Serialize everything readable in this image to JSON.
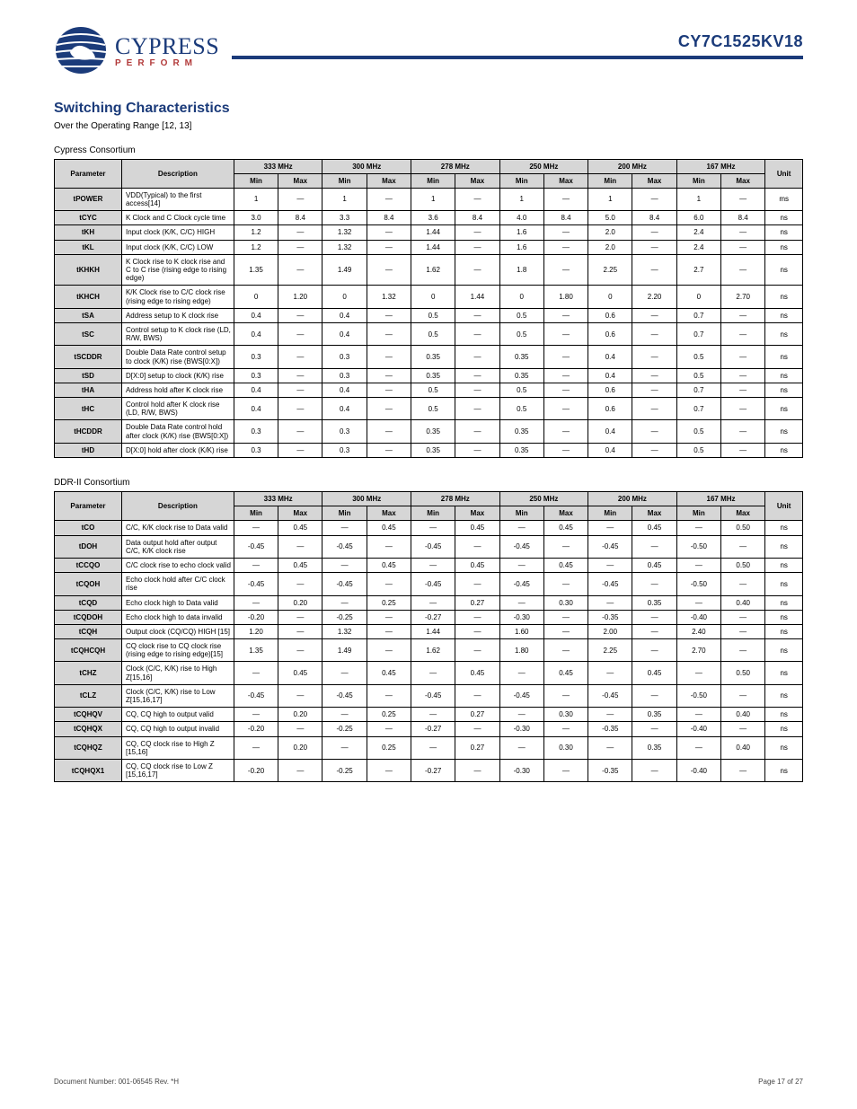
{
  "brand": {
    "name": "CYPRESS",
    "tag": "PERFORM"
  },
  "part_number": "CY7C1525KV18",
  "section_title": "Switching Characteristics",
  "section_intro": "Over the Operating Range [12, 13]",
  "table1_caption": "Cypress Consortium",
  "table2_caption": "DDR-II Consortium",
  "headers": [
    "Parameter",
    "Description",
    "333 MHz",
    "300 MHz",
    "278 MHz",
    "250 MHz",
    "200 MHz",
    "167 MHz",
    "Unit"
  ],
  "subheaders": [
    "",
    "",
    "Min",
    "Max",
    "Min",
    "Max",
    "Min",
    "Max",
    "Min",
    "Max",
    "Min",
    "Max",
    "Min",
    "Max",
    ""
  ],
  "cons_t1_cols": [
    "Parameter",
    "Description",
    "Min",
    "Max",
    "Min",
    "Max",
    "Min",
    "Max",
    "Min",
    "Max",
    "Min",
    "Max",
    "Min",
    "Max",
    "Unit"
  ],
  "t1_freq_row": [
    "",
    "",
    "333 MHz",
    "300 MHz",
    "278 MHz",
    "250 MHz",
    "200 MHz",
    "167 MHz",
    ""
  ],
  "t1_rows": [
    [
      "tPOWER",
      "",
      "VDD(Typical) to the first access[14]",
      "1",
      "—",
      "1",
      "—",
      "1",
      "—",
      "1",
      "—",
      "1",
      "—",
      "1",
      "—",
      "ms"
    ],
    [
      "tCYC",
      "",
      "K Clock and C Clock cycle time",
      "3.0",
      "8.4",
      "3.3",
      "8.4",
      "3.6",
      "8.4",
      "4.0",
      "8.4",
      "5.0",
      "8.4",
      "6.0",
      "8.4",
      "ns"
    ],
    [
      "tKH",
      "",
      "Input clock (K/K, C/C) HIGH",
      "1.2",
      "—",
      "1.32",
      "—",
      "1.44",
      "—",
      "1.6",
      "—",
      "2.0",
      "—",
      "2.4",
      "—",
      "ns"
    ],
    [
      "tKL",
      "",
      "Input clock (K/K, C/C) LOW",
      "1.2",
      "—",
      "1.32",
      "—",
      "1.44",
      "—",
      "1.6",
      "—",
      "2.0",
      "—",
      "2.4",
      "—",
      "ns"
    ],
    [
      "tKHKH",
      "",
      "K Clock rise to K clock rise and C\nto C rise (rising edge to rising edge)",
      "1.35",
      "—",
      "1.49",
      "—",
      "1.62",
      "—",
      "1.8",
      "—",
      "2.25",
      "—",
      "2.7",
      "—",
      "ns"
    ],
    [
      "tKHCH",
      "",
      "K/K Clock rise to C/C clock rise\n(rising edge to rising edge)",
      "0",
      "1.20",
      "0",
      "1.32",
      "0",
      "1.44",
      "0",
      "1.80",
      "0",
      "2.20",
      "0",
      "2.70",
      "ns"
    ],
    [
      "tSA",
      "",
      "Address setup to K clock rise",
      "0.4",
      "—",
      "0.4",
      "—",
      "0.5",
      "—",
      "0.5",
      "—",
      "0.6",
      "—",
      "0.7",
      "—",
      "ns"
    ],
    [
      "tSC",
      "",
      "Control setup to K clock rise\n(LD, R/W, BWS)",
      "0.4",
      "—",
      "0.4",
      "—",
      "0.5",
      "—",
      "0.5",
      "—",
      "0.6",
      "—",
      "0.7",
      "—",
      "ns"
    ],
    [
      "tSCDDR",
      "",
      "Double Data Rate control setup to\nclock (K/K) rise (BWS[0:X])",
      "0.3",
      "—",
      "0.3",
      "—",
      "0.35",
      "—",
      "0.35",
      "—",
      "0.4",
      "—",
      "0.5",
      "—",
      "ns"
    ],
    [
      "tSD",
      "",
      "D[X:0] setup to clock (K/K) rise",
      "0.3",
      "—",
      "0.3",
      "—",
      "0.35",
      "—",
      "0.35",
      "—",
      "0.4",
      "—",
      "0.5",
      "—",
      "ns"
    ],
    [
      "tHA",
      "",
      "Address hold after K clock rise",
      "0.4",
      "—",
      "0.4",
      "—",
      "0.5",
      "—",
      "0.5",
      "—",
      "0.6",
      "—",
      "0.7",
      "—",
      "ns"
    ],
    [
      "tHC",
      "",
      "Control hold after K clock rise\n(LD, R/W, BWS)",
      "0.4",
      "—",
      "0.4",
      "—",
      "0.5",
      "—",
      "0.5",
      "—",
      "0.6",
      "—",
      "0.7",
      "—",
      "ns"
    ],
    [
      "tHCDDR",
      "",
      "Double Data Rate control hold after\nclock (K/K) rise (BWS[0:X])",
      "0.3",
      "—",
      "0.3",
      "—",
      "0.35",
      "—",
      "0.35",
      "—",
      "0.4",
      "—",
      "0.5",
      "—",
      "ns"
    ],
    [
      "tHD",
      "",
      "D[X:0] hold after clock (K/K) rise",
      "0.3",
      "—",
      "0.3",
      "—",
      "0.35",
      "—",
      "0.35",
      "—",
      "0.4",
      "—",
      "0.5",
      "—",
      "ns"
    ]
  ],
  "t2_rows": [
    [
      "tCO",
      "",
      "C/C, K/K clock rise to Data valid",
      "—",
      "0.45",
      "—",
      "0.45",
      "—",
      "0.45",
      "—",
      "0.45",
      "—",
      "0.45",
      "—",
      "0.50",
      "ns"
    ],
    [
      "tDOH",
      "",
      "Data output hold after output\nC/C, K/K clock rise",
      "-0.45",
      "—",
      "-0.45",
      "—",
      "-0.45",
      "—",
      "-0.45",
      "—",
      "-0.45",
      "—",
      "-0.50",
      "—",
      "ns"
    ],
    [
      "tCCQO",
      "",
      "C/C clock rise to echo clock valid",
      "—",
      "0.45",
      "—",
      "0.45",
      "—",
      "0.45",
      "—",
      "0.45",
      "—",
      "0.45",
      "—",
      "0.50",
      "ns"
    ],
    [
      "tCQOH",
      "",
      "Echo clock hold after\nC/C clock rise",
      "-0.45",
      "—",
      "-0.45",
      "—",
      "-0.45",
      "—",
      "-0.45",
      "—",
      "-0.45",
      "—",
      "-0.50",
      "—",
      "ns"
    ],
    [
      "tCQD",
      "",
      "Echo clock high to Data valid",
      "—",
      "0.20",
      "—",
      "0.25",
      "—",
      "0.27",
      "—",
      "0.30",
      "—",
      "0.35",
      "—",
      "0.40",
      "ns"
    ],
    [
      "tCQDOH",
      "",
      "Echo clock high to data\ninvalid",
      "-0.20",
      "—",
      "-0.25",
      "—",
      "-0.27",
      "—",
      "-0.30",
      "—",
      "-0.35",
      "—",
      "-0.40",
      "—",
      "ns"
    ],
    [
      "tCQH",
      "",
      "Output clock (CQ/CQ) HIGH [15]",
      "1.20",
      "—",
      "1.32",
      "—",
      "1.44",
      "—",
      "1.60",
      "—",
      "2.00",
      "—",
      "2.40",
      "—",
      "ns"
    ],
    [
      "tCQHCQH",
      "",
      "CQ clock rise to CQ clock rise\n(rising edge to rising edge)[15]",
      "1.35",
      "—",
      "1.49",
      "—",
      "1.62",
      "—",
      "1.80",
      "—",
      "2.25",
      "—",
      "2.70",
      "—",
      "ns"
    ],
    [
      "tCHZ",
      "",
      "Clock (C/C, K/K) rise to\nHigh Z[15,16]",
      "—",
      "0.45",
      "—",
      "0.45",
      "—",
      "0.45",
      "—",
      "0.45",
      "—",
      "0.45",
      "—",
      "0.50",
      "ns"
    ],
    [
      "tCLZ",
      "",
      "Clock (C/C, K/K) rise to\nLow Z[15,16,17]",
      "-0.45",
      "—",
      "-0.45",
      "—",
      "-0.45",
      "—",
      "-0.45",
      "—",
      "-0.45",
      "—",
      "-0.50",
      "—",
      "ns"
    ],
    [
      "tCQHQV",
      "",
      "CQ, CQ high to output valid",
      "—",
      "0.20",
      "—",
      "0.25",
      "—",
      "0.27",
      "—",
      "0.30",
      "—",
      "0.35",
      "—",
      "0.40",
      "ns"
    ],
    [
      "tCQHQX",
      "",
      "CQ, CQ high to output invalid",
      "-0.20",
      "—",
      "-0.25",
      "—",
      "-0.27",
      "—",
      "-0.30",
      "—",
      "-0.35",
      "—",
      "-0.40",
      "—",
      "ns"
    ],
    [
      "tCQHQZ",
      "",
      "CQ, CQ clock rise to\nHigh Z [15,16]",
      "—",
      "0.20",
      "—",
      "0.25",
      "—",
      "0.27",
      "—",
      "0.30",
      "—",
      "0.35",
      "—",
      "0.40",
      "ns"
    ],
    [
      "tCQHQX1",
      "",
      "CQ, CQ clock rise to\nLow Z [15,16,17]",
      "-0.20",
      "—",
      "-0.25",
      "—",
      "-0.27",
      "—",
      "-0.30",
      "—",
      "-0.35",
      "—",
      "-0.40",
      "—",
      "ns"
    ]
  ],
  "footer": {
    "left": "Document Number: 001-06545 Rev. *H",
    "right": "Page 17 of 27"
  },
  "page_number": "17"
}
